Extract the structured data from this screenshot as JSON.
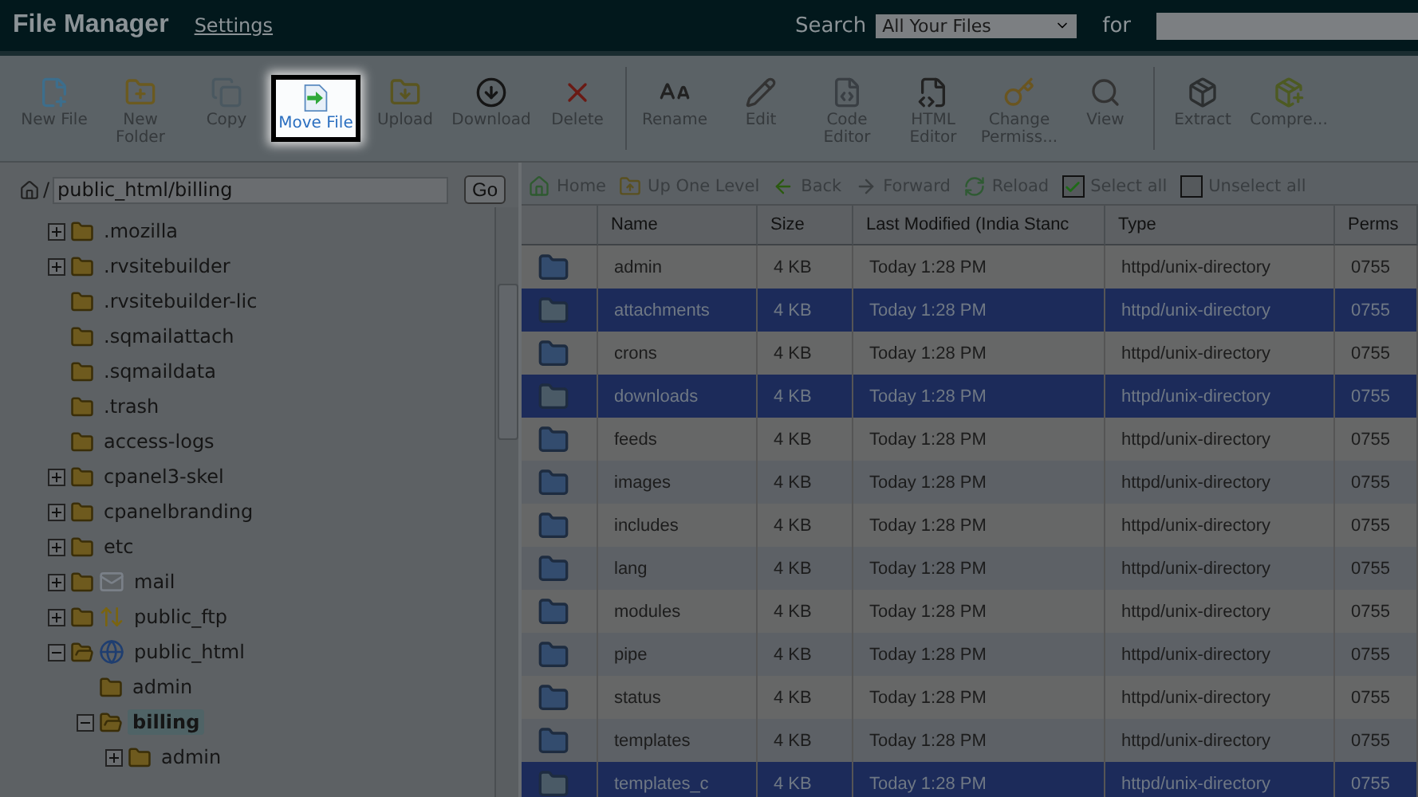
{
  "header": {
    "title": "File Manager",
    "settings_link": "Settings",
    "search_label": "Search",
    "search_scope": "All Your Files",
    "for_label": "for"
  },
  "toolbar": {
    "groups": [
      [
        {
          "kind": "newfile",
          "label": "New File",
          "highlighted": false
        },
        {
          "kind": "newfolder",
          "label": "New Folder",
          "highlighted": false
        },
        {
          "kind": "copy",
          "label": "Copy",
          "highlighted": false
        },
        {
          "kind": "move",
          "label": "Move File",
          "highlighted": true
        },
        {
          "kind": "upload",
          "label": "Upload",
          "highlighted": false
        },
        {
          "kind": "download",
          "label": "Download",
          "highlighted": false
        },
        {
          "kind": "delete",
          "label": "Delete",
          "highlighted": false
        }
      ],
      [
        {
          "kind": "rename",
          "label": "Rename",
          "highlighted": false
        },
        {
          "kind": "edit",
          "label": "Edit",
          "highlighted": false
        },
        {
          "kind": "code",
          "label": "Code Editor",
          "highlighted": false
        },
        {
          "kind": "html",
          "label": "HTML Editor",
          "highlighted": false
        },
        {
          "kind": "perms",
          "label": "Change Permiss...",
          "highlighted": false
        },
        {
          "kind": "view",
          "label": "View",
          "highlighted": false
        }
      ],
      [
        {
          "kind": "extract",
          "label": "Extract",
          "highlighted": false
        },
        {
          "kind": "compress",
          "label": "Compre...",
          "highlighted": false
        }
      ]
    ]
  },
  "path_bar": {
    "prefix": "/",
    "path": "public_html/billing",
    "go_button": "Go"
  },
  "tree": [
    {
      "name": ".mozilla",
      "expandable": true,
      "expanded": false,
      "selected": false
    },
    {
      "name": ".rvsitebuilder",
      "expandable": true,
      "expanded": false,
      "selected": false
    },
    {
      "name": ".rvsitebuilder-lic",
      "expandable": false,
      "expanded": false,
      "selected": false
    },
    {
      "name": ".sqmailattach",
      "expandable": false,
      "expanded": false,
      "selected": false
    },
    {
      "name": ".sqmaildata",
      "expandable": false,
      "expanded": false,
      "selected": false
    },
    {
      "name": ".trash",
      "expandable": false,
      "expanded": false,
      "selected": false
    },
    {
      "name": "access-logs",
      "expandable": false,
      "expanded": false,
      "selected": false
    },
    {
      "name": "cpanel3-skel",
      "expandable": true,
      "expanded": false,
      "selected": false
    },
    {
      "name": "cpanelbranding",
      "expandable": true,
      "expanded": false,
      "selected": false
    },
    {
      "name": "etc",
      "expandable": true,
      "expanded": false,
      "selected": false
    },
    {
      "name": "mail",
      "expandable": true,
      "expanded": false,
      "kind": "mail",
      "selected": false
    },
    {
      "name": "public_ftp",
      "expandable": true,
      "expanded": false,
      "kind": "ftp",
      "selected": false
    },
    {
      "name": "public_html",
      "expandable": true,
      "expanded": true,
      "kind": "web",
      "selected": false,
      "children": [
        {
          "name": "admin",
          "expandable": false,
          "expanded": false,
          "selected": false
        },
        {
          "name": "billing",
          "expandable": true,
          "expanded": true,
          "selected": true,
          "children": [
            {
              "name": "admin",
              "expandable": true,
              "expanded": false,
              "selected": false
            }
          ]
        }
      ]
    }
  ],
  "nav": [
    {
      "kind": "home",
      "label": "Home"
    },
    {
      "kind": "up",
      "label": "Up One Level"
    },
    {
      "kind": "back",
      "label": "Back"
    },
    {
      "kind": "forward",
      "label": "Forward"
    },
    {
      "kind": "reload",
      "label": "Reload"
    },
    {
      "kind": "selectall",
      "label": "Select all"
    },
    {
      "kind": "unselectall",
      "label": "Unselect all"
    }
  ],
  "table": {
    "columns": [
      "Name",
      "Size",
      "Last Modified (India Stanc",
      "Type",
      "Perms"
    ],
    "rows": [
      {
        "cells": [
          "admin",
          "4 KB",
          "Today 1:28 PM",
          "httpd/unix-directory",
          "0755"
        ],
        "selected": false
      },
      {
        "cells": [
          "attachments",
          "4 KB",
          "Today 1:28 PM",
          "httpd/unix-directory",
          "0755"
        ],
        "selected": true
      },
      {
        "cells": [
          "crons",
          "4 KB",
          "Today 1:28 PM",
          "httpd/unix-directory",
          "0755"
        ],
        "selected": false
      },
      {
        "cells": [
          "downloads",
          "4 KB",
          "Today 1:28 PM",
          "httpd/unix-directory",
          "0755"
        ],
        "selected": true
      },
      {
        "cells": [
          "feeds",
          "4 KB",
          "Today 1:28 PM",
          "httpd/unix-directory",
          "0755"
        ],
        "selected": false
      },
      {
        "cells": [
          "images",
          "4 KB",
          "Today 1:28 PM",
          "httpd/unix-directory",
          "0755"
        ],
        "selected": false
      },
      {
        "cells": [
          "includes",
          "4 KB",
          "Today 1:28 PM",
          "httpd/unix-directory",
          "0755"
        ],
        "selected": false
      },
      {
        "cells": [
          "lang",
          "4 KB",
          "Today 1:28 PM",
          "httpd/unix-directory",
          "0755"
        ],
        "selected": false
      },
      {
        "cells": [
          "modules",
          "4 KB",
          "Today 1:28 PM",
          "httpd/unix-directory",
          "0755"
        ],
        "selected": false
      },
      {
        "cells": [
          "pipe",
          "4 KB",
          "Today 1:28 PM",
          "httpd/unix-directory",
          "0755"
        ],
        "selected": false
      },
      {
        "cells": [
          "status",
          "4 KB",
          "Today 1:28 PM",
          "httpd/unix-directory",
          "0755"
        ],
        "selected": false
      },
      {
        "cells": [
          "templates",
          "4 KB",
          "Today 1:28 PM",
          "httpd/unix-directory",
          "0755"
        ],
        "selected": false
      },
      {
        "cells": [
          "templates_c",
          "4 KB",
          "Today 1:28 PM",
          "httpd/unix-directory",
          "0755"
        ],
        "selected": true
      }
    ]
  }
}
